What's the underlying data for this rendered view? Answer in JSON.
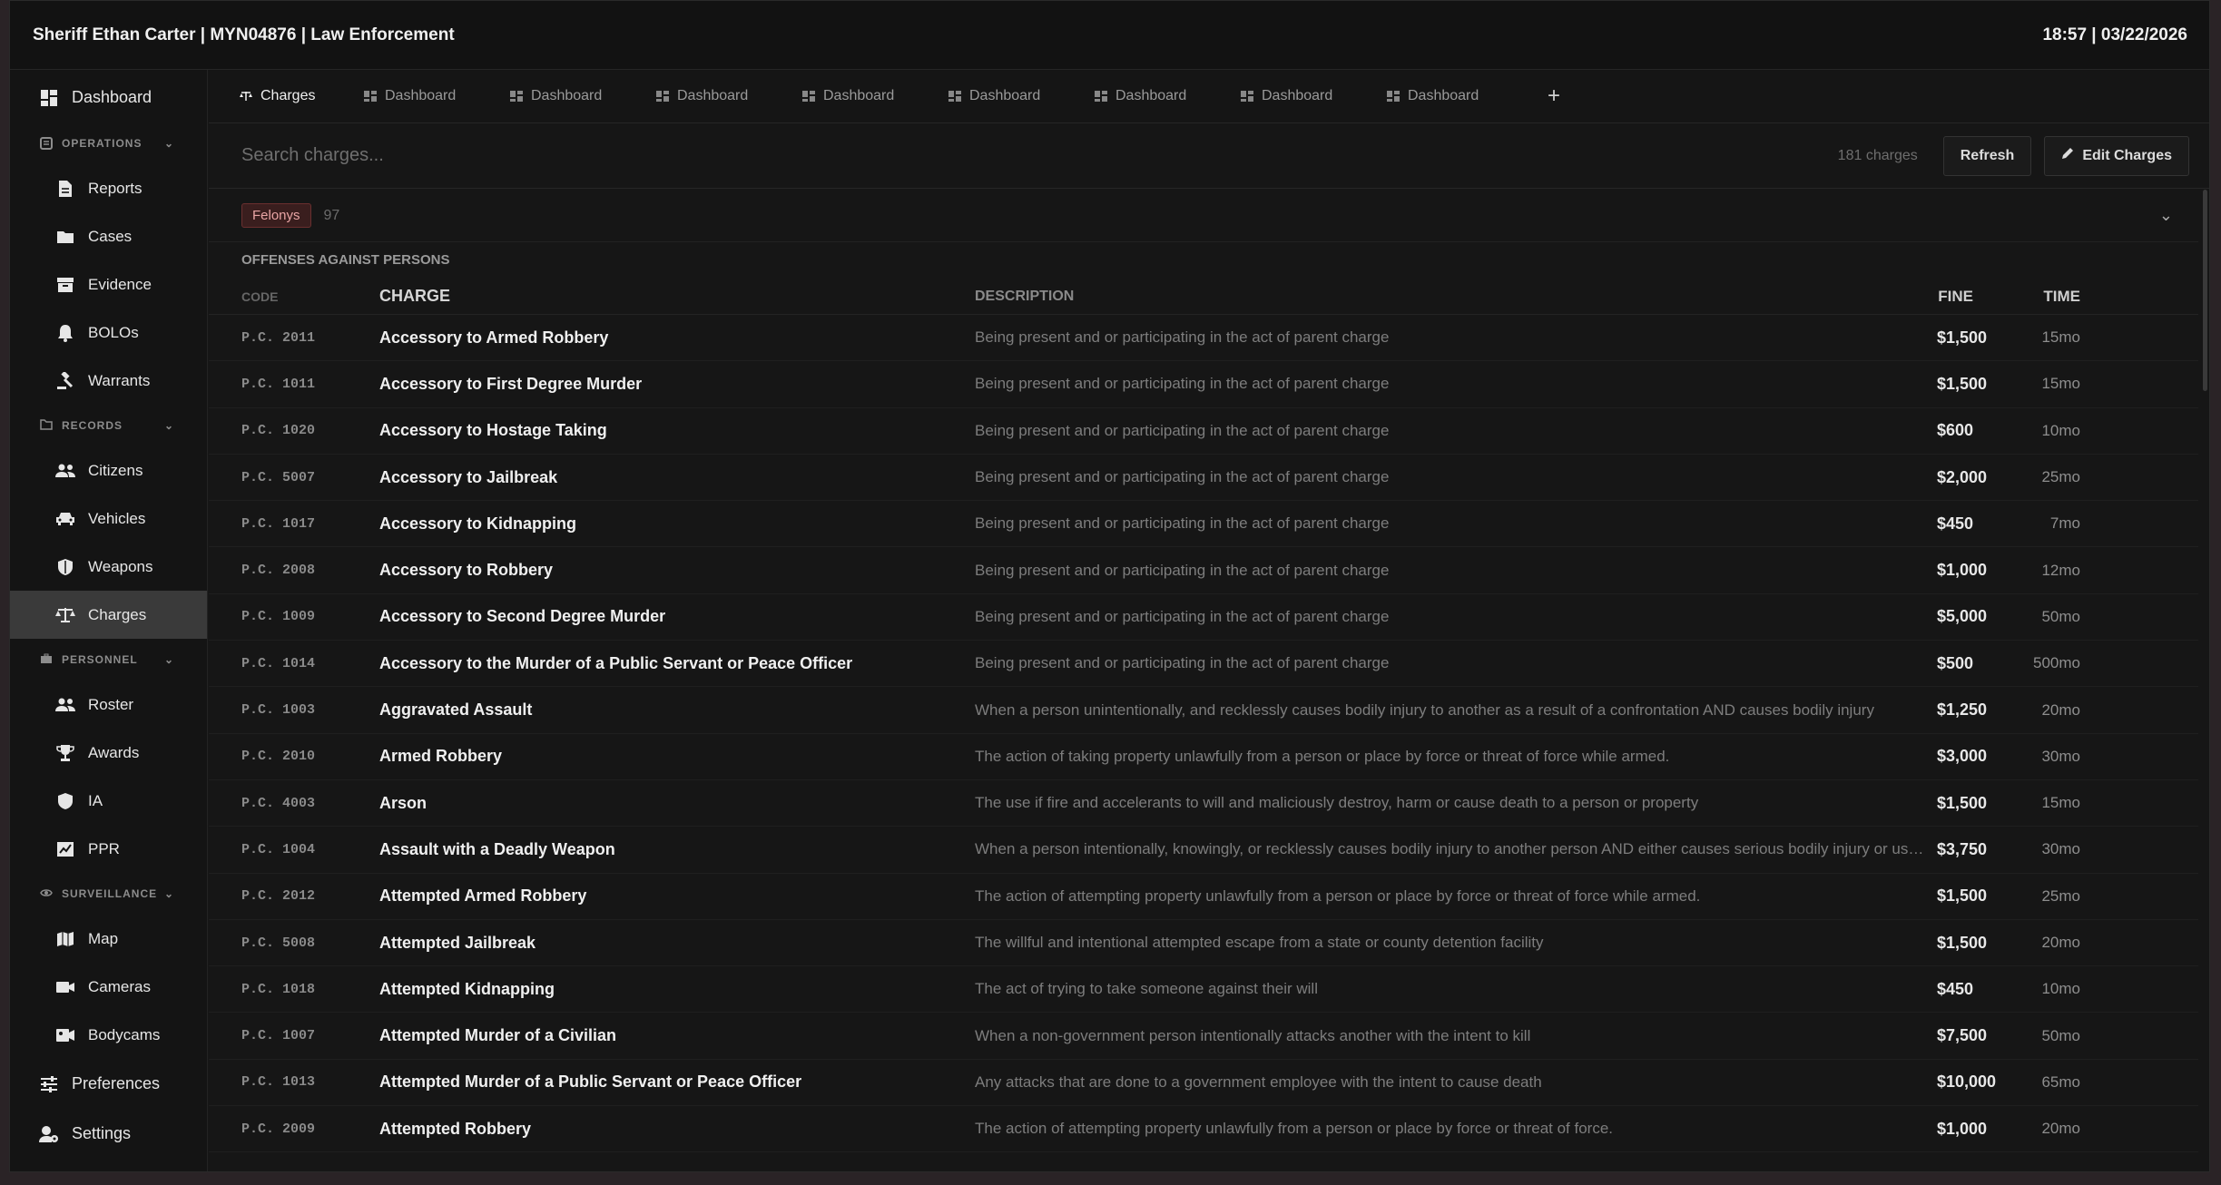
{
  "header": {
    "title": "Sheriff Ethan Carter | MYN04876 | Law Enforcement",
    "clock": "18:57 | 03/22/2026"
  },
  "sidebar": {
    "dashboard": "Dashboard",
    "operations": {
      "label": "OPERATIONS",
      "items": [
        "Reports",
        "Cases",
        "Evidence",
        "BOLOs",
        "Warrants"
      ]
    },
    "records": {
      "label": "RECORDS",
      "items": [
        "Citizens",
        "Vehicles",
        "Weapons",
        "Charges"
      ]
    },
    "personnel": {
      "label": "PERSONNEL",
      "items": [
        "Roster",
        "Awards",
        "IA",
        "PPR"
      ]
    },
    "surveillance": {
      "label": "SURVEILLANCE",
      "items": [
        "Map",
        "Cameras",
        "Bodycams"
      ]
    },
    "preferences": "Preferences",
    "settings": "Settings"
  },
  "tabs": [
    "Charges",
    "Dashboard",
    "Dashboard",
    "Dashboard",
    "Dashboard",
    "Dashboard",
    "Dashboard",
    "Dashboard",
    "Dashboard"
  ],
  "tab_add": "+",
  "search": {
    "placeholder": "Search charges...",
    "count": "181 charges",
    "refresh": "Refresh",
    "edit": "Edit Charges"
  },
  "group": {
    "badge": "Felonys",
    "count": "97",
    "category": "OFFENSES AGAINST PERSONS"
  },
  "columns": {
    "code": "CODE",
    "charge": "CHARGE",
    "description": "DESCRIPTION",
    "fine": "FINE",
    "time": "TIME"
  },
  "rows": [
    {
      "code": "P.C. 2011",
      "charge": "Accessory to Armed Robbery",
      "description": "Being present and or participating in the act of parent charge",
      "fine": "$1,500",
      "time": "15mo"
    },
    {
      "code": "P.C. 1011",
      "charge": "Accessory to First Degree Murder",
      "description": "Being present and or participating in the act of parent charge",
      "fine": "$1,500",
      "time": "15mo"
    },
    {
      "code": "P.C. 1020",
      "charge": "Accessory to Hostage Taking",
      "description": "Being present and or participating in the act of parent charge",
      "fine": "$600",
      "time": "10mo"
    },
    {
      "code": "P.C. 5007",
      "charge": "Accessory to Jailbreak",
      "description": "Being present and or participating in the act of parent charge",
      "fine": "$2,000",
      "time": "25mo"
    },
    {
      "code": "P.C. 1017",
      "charge": "Accessory to Kidnapping",
      "description": "Being present and or participating in the act of parent charge",
      "fine": "$450",
      "time": "7mo"
    },
    {
      "code": "P.C. 2008",
      "charge": "Accessory to Robbery",
      "description": "Being present and or participating in the act of parent charge",
      "fine": "$1,000",
      "time": "12mo"
    },
    {
      "code": "P.C. 1009",
      "charge": "Accessory to Second Degree Murder",
      "description": "Being present and or participating in the act of parent charge",
      "fine": "$5,000",
      "time": "50mo"
    },
    {
      "code": "P.C. 1014",
      "charge": "Accessory to the Murder of a Public Servant or Peace Officer",
      "description": "Being present and or participating in the act of parent charge",
      "fine": "$500",
      "time": "500mo"
    },
    {
      "code": "P.C. 1003",
      "charge": "Aggravated Assault",
      "description": "When a person unintentionally, and recklessly causes bodily injury to another as a result of a confrontation AND causes bodily injury",
      "fine": "$1,250",
      "time": "20mo"
    },
    {
      "code": "P.C. 2010",
      "charge": "Armed Robbery",
      "description": "The action of taking property unlawfully from a person or place by force or threat of force while armed.",
      "fine": "$3,000",
      "time": "30mo"
    },
    {
      "code": "P.C. 4003",
      "charge": "Arson",
      "description": "The use if fire and accelerants to will and maliciously destroy, harm or cause death to a person or property",
      "fine": "$1,500",
      "time": "15mo"
    },
    {
      "code": "P.C. 1004",
      "charge": "Assault with a Deadly Weapon",
      "description": "When a person intentionally, knowingly, or recklessly causes bodily injury to another person AND either causes serious bodily injury or use...",
      "fine": "$3,750",
      "time": "30mo"
    },
    {
      "code": "P.C. 2012",
      "charge": "Attempted Armed Robbery",
      "description": "The action of attempting property unlawfully from a person or place by force or threat of force while armed.",
      "fine": "$1,500",
      "time": "25mo"
    },
    {
      "code": "P.C. 5008",
      "charge": "Attempted Jailbreak",
      "description": "The willful and intentional attempted escape from a state or county detention facility",
      "fine": "$1,500",
      "time": "20mo"
    },
    {
      "code": "P.C. 1018",
      "charge": "Attempted Kidnapping",
      "description": "The act of trying to take someone against their will",
      "fine": "$450",
      "time": "10mo"
    },
    {
      "code": "P.C. 1007",
      "charge": "Attempted Murder of a Civilian",
      "description": "When a non-government person intentionally attacks another with the intent to kill",
      "fine": "$7,500",
      "time": "50mo"
    },
    {
      "code": "P.C. 1013",
      "charge": "Attempted Murder of a Public Servant or Peace Officer",
      "description": "Any attacks that are done to a government employee with the intent to cause death",
      "fine": "$10,000",
      "time": "65mo"
    },
    {
      "code": "P.C. 2009",
      "charge": "Attempted Robbery",
      "description": "The action of attempting property unlawfully from a person or place by force or threat of force.",
      "fine": "$1,000",
      "time": "20mo"
    }
  ]
}
